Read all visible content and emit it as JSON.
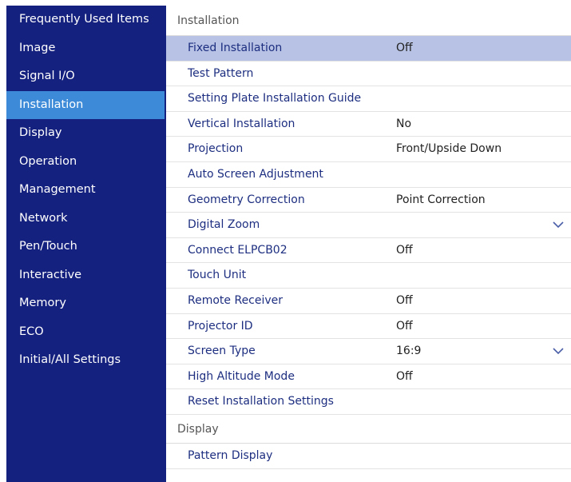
{
  "sidebar": {
    "items": [
      {
        "label": "Frequently Used Items"
      },
      {
        "label": "Image"
      },
      {
        "label": "Signal I/O"
      },
      {
        "label": "Installation",
        "active": true
      },
      {
        "label": "Display"
      },
      {
        "label": "Operation"
      },
      {
        "label": "Management"
      },
      {
        "label": "Network"
      },
      {
        "label": "Pen/Touch"
      },
      {
        "label": "Interactive"
      },
      {
        "label": "Memory"
      },
      {
        "label": "ECO"
      },
      {
        "label": "Initial/All Settings"
      }
    ]
  },
  "main": {
    "installation_header": "Installation",
    "rows": [
      {
        "label": "Fixed Installation",
        "value": "Off",
        "selected": true
      },
      {
        "label": "Test Pattern",
        "value": ""
      },
      {
        "label": "Setting Plate Installation Guide",
        "value": ""
      },
      {
        "label": "Vertical Installation",
        "value": "No"
      },
      {
        "label": "Projection",
        "value": "Front/Upside Down"
      },
      {
        "label": "Auto Screen Adjustment",
        "value": ""
      },
      {
        "label": "Geometry Correction",
        "value": "Point Correction"
      },
      {
        "label": "Digital Zoom",
        "value": "",
        "chevron": true
      },
      {
        "label": "Connect ELPCB02",
        "value": "Off"
      },
      {
        "label": "Touch Unit",
        "value": ""
      },
      {
        "label": "Remote Receiver",
        "value": "Off"
      },
      {
        "label": "Projector ID",
        "value": "Off"
      },
      {
        "label": "Screen Type",
        "value": "16:9",
        "chevron": true
      },
      {
        "label": "High Altitude Mode",
        "value": "Off"
      },
      {
        "label": "Reset Installation Settings",
        "value": ""
      }
    ],
    "display_header": "Display",
    "display_rows": [
      {
        "label": "Pattern Display",
        "value": ""
      }
    ]
  },
  "colors": {
    "sidebar_bg": "#15217e",
    "sidebar_active": "#3d8bd8",
    "row_selected": "#b7c2e4",
    "row_text": "#1d2e80"
  }
}
